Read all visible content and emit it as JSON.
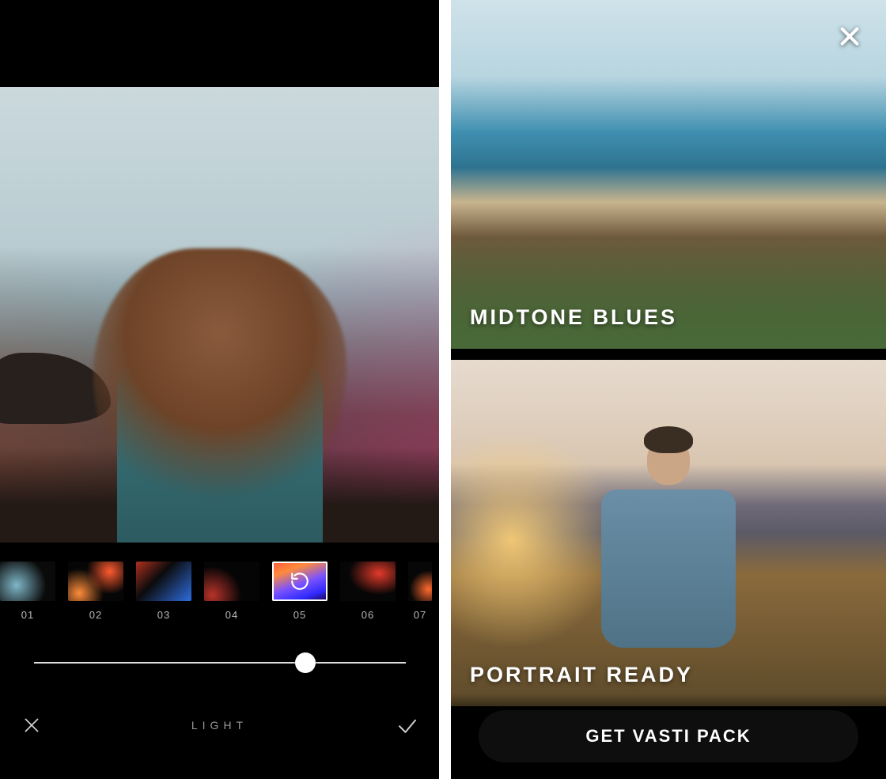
{
  "editor": {
    "mode_label": "LIGHT",
    "slider_percent": 73,
    "selected_filter_index": 4,
    "filters": [
      {
        "label": "01"
      },
      {
        "label": "02"
      },
      {
        "label": "03"
      },
      {
        "label": "04"
      },
      {
        "label": "05"
      },
      {
        "label": "06"
      },
      {
        "label": "07"
      }
    ]
  },
  "pack_preview": {
    "cards": [
      {
        "title": "MIDTONE BLUES"
      },
      {
        "title": "PORTRAIT READY"
      }
    ],
    "cta_label": "GET VASTI PACK"
  }
}
